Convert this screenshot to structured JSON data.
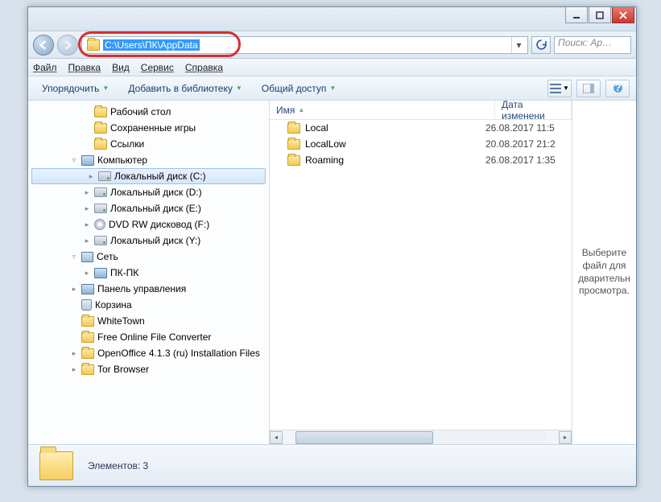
{
  "address_path": "C:\\Users\\ПК\\AppData",
  "search_placeholder": "Поиск: Ap…",
  "menu": {
    "file": "Файл",
    "edit": "Правка",
    "view": "Вид",
    "tools": "Сервис",
    "help": "Справка"
  },
  "toolbar": {
    "organize": "Упорядочить",
    "addlib": "Добавить в библиотеку",
    "share": "Общий доступ"
  },
  "columns": {
    "name": "Имя",
    "modified": "Дата изменени"
  },
  "tree": [
    {
      "label": "Рабочий стол",
      "icon": "folder",
      "indent": "ind1"
    },
    {
      "label": "Сохраненные игры",
      "icon": "folder",
      "indent": "ind1"
    },
    {
      "label": "Ссылки",
      "icon": "folder",
      "indent": "ind1"
    },
    {
      "label": "Компьютер",
      "icon": "comp",
      "indent": "ind2",
      "exp": "▿"
    },
    {
      "label": "Локальный диск (C:)",
      "icon": "drive",
      "indent": "ind3",
      "sel": true,
      "exp": "▸"
    },
    {
      "label": "Локальный диск (D:)",
      "icon": "drive",
      "indent": "ind3",
      "exp": "▸"
    },
    {
      "label": "Локальный диск (E:)",
      "icon": "drive",
      "indent": "ind3",
      "exp": "▸"
    },
    {
      "label": "DVD RW дисковод (F:)",
      "icon": "disc",
      "indent": "ind3",
      "exp": "▸"
    },
    {
      "label": "Локальный диск (Y:)",
      "icon": "drive",
      "indent": "ind3",
      "exp": "▸"
    },
    {
      "label": "Сеть",
      "icon": "net",
      "indent": "ind2",
      "exp": "▿"
    },
    {
      "label": "ПК-ПК",
      "icon": "comp",
      "indent": "ind3",
      "exp": "▸"
    },
    {
      "label": "Панель управления",
      "icon": "comp",
      "indent": "ind2",
      "exp": "▸"
    },
    {
      "label": "Корзина",
      "icon": "bin",
      "indent": "ind2"
    },
    {
      "label": "WhiteTown",
      "icon": "folder",
      "indent": "ind2"
    },
    {
      "label": "Free Online File Converter",
      "icon": "folder",
      "indent": "ind2"
    },
    {
      "label": "OpenOffice 4.1.3 (ru) Installation Files",
      "icon": "folder",
      "indent": "ind2",
      "exp": "▸"
    },
    {
      "label": "Tor Browser",
      "icon": "folder",
      "indent": "ind2",
      "exp": "▸"
    }
  ],
  "files": [
    {
      "name": "Local",
      "date": "26.08.2017 11:5"
    },
    {
      "name": "LocalLow",
      "date": "20.08.2017 21:2"
    },
    {
      "name": "Roaming",
      "date": "26.08.2017 1:35"
    }
  ],
  "preview_text": "Выберите файл для дварительн просмотра.",
  "status_text": "Элементов: 3"
}
